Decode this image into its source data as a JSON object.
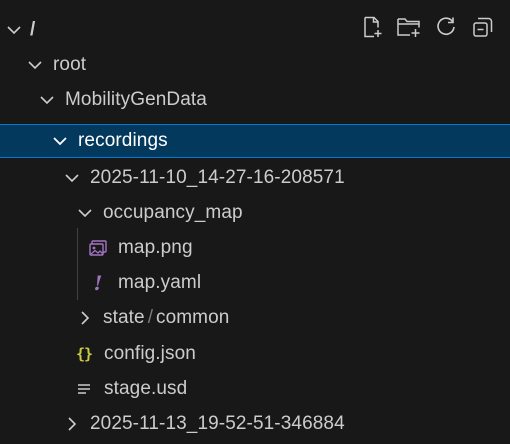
{
  "toolbar": {
    "new_file_icon": "new-file-icon",
    "new_folder_icon": "new-folder-icon",
    "refresh_icon": "refresh-icon",
    "collapse_all_icon": "collapse-all-icon"
  },
  "tree": {
    "root": {
      "label": "/",
      "expanded": true
    },
    "root_dir": {
      "label": "root",
      "expanded": true
    },
    "mobility": {
      "label": "MobilityGenData",
      "expanded": true
    },
    "recordings": {
      "label": "recordings",
      "expanded": true,
      "selected": true
    },
    "rec1": {
      "label": "2025-11-10_14-27-16-208571",
      "expanded": true
    },
    "occupancy_map": {
      "label": "occupancy_map",
      "expanded": true
    },
    "map_png": {
      "label": "map.png",
      "icon": "image-file-icon"
    },
    "map_yaml": {
      "label": "map.yaml",
      "icon": "yaml-file-icon"
    },
    "state": {
      "label": "state",
      "sep": "/",
      "child": "common",
      "expanded": false
    },
    "config_json": {
      "label": "config.json",
      "icon": "json-file-icon",
      "glyph": "{}"
    },
    "stage_usd": {
      "label": "stage.usd",
      "icon": "text-file-icon"
    },
    "rec2": {
      "label": "2025-11-13_19-52-51-346884",
      "expanded": false
    }
  },
  "colors": {
    "background": "#181818",
    "selection": "#04395e",
    "selection_border": "#0078d4",
    "text": "#cccccc",
    "json_icon": "#cbcb41",
    "yaml_icon": "#a074c4",
    "image_icon": "#a074c4"
  }
}
